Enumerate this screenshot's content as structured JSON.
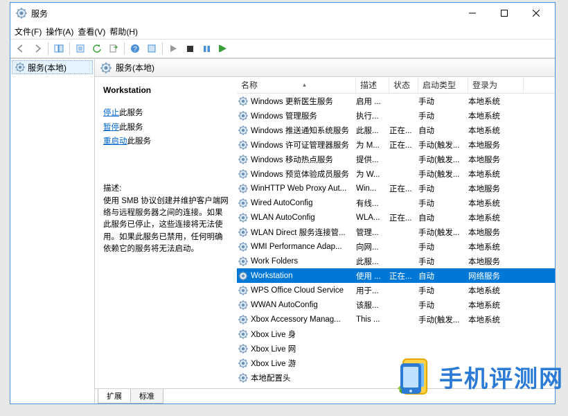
{
  "window": {
    "title": "服务"
  },
  "menu": {
    "file": "文件(F)",
    "action": "操作(A)",
    "view": "查看(V)",
    "help": "帮助(H)"
  },
  "tree": {
    "root": "服务(本地)"
  },
  "header": {
    "label": "服务(本地)"
  },
  "detail": {
    "name": "Workstation",
    "stop_link": "停止",
    "stop_suffix": "此服务",
    "pause_link": "暂停",
    "pause_suffix": "此服务",
    "restart_link": "重启动",
    "restart_suffix": "此服务",
    "desc_label": "描述:",
    "desc": "使用 SMB 协议创建并维护客户端网络与远程服务器之间的连接。如果此服务已停止，这些连接将无法使用。如果此服务已禁用，任何明确依赖它的服务将无法启动。"
  },
  "columns": {
    "name": "名称",
    "desc": "描述",
    "status": "状态",
    "start": "启动类型",
    "logon": "登录为"
  },
  "rows": [
    {
      "name": "Windows 更新医生服务",
      "desc": "启用 ...",
      "status": "",
      "start": "手动",
      "logon": "本地系统"
    },
    {
      "name": "Windows 管理服务",
      "desc": "执行...",
      "status": "",
      "start": "手动",
      "logon": "本地系统"
    },
    {
      "name": "Windows 推送通知系统服务",
      "desc": "此服...",
      "status": "正在...",
      "start": "自动",
      "logon": "本地系统"
    },
    {
      "name": "Windows 许可证管理器服务",
      "desc": "为 M...",
      "status": "正在...",
      "start": "手动(触发...",
      "logon": "本地服务"
    },
    {
      "name": "Windows 移动热点服务",
      "desc": "提供...",
      "status": "",
      "start": "手动(触发...",
      "logon": "本地服务"
    },
    {
      "name": "Windows 预览体验成员服务",
      "desc": "为 W...",
      "status": "",
      "start": "手动(触发...",
      "logon": "本地系统"
    },
    {
      "name": "WinHTTP Web Proxy Aut...",
      "desc": "Win...",
      "status": "正在...",
      "start": "手动",
      "logon": "本地服务"
    },
    {
      "name": "Wired AutoConfig",
      "desc": "有线...",
      "status": "",
      "start": "手动",
      "logon": "本地系统"
    },
    {
      "name": "WLAN AutoConfig",
      "desc": "WLA...",
      "status": "正在...",
      "start": "自动",
      "logon": "本地系统"
    },
    {
      "name": "WLAN Direct 服务连接管...",
      "desc": "管理...",
      "status": "",
      "start": "手动(触发...",
      "logon": "本地服务"
    },
    {
      "name": "WMI Performance Adap...",
      "desc": "向网...",
      "status": "",
      "start": "手动",
      "logon": "本地系统"
    },
    {
      "name": "Work Folders",
      "desc": "此服...",
      "status": "",
      "start": "手动",
      "logon": "本地服务"
    },
    {
      "name": "Workstation",
      "desc": "使用 ...",
      "status": "正在...",
      "start": "自动",
      "logon": "网络服务",
      "selected": true
    },
    {
      "name": "WPS Office Cloud Service",
      "desc": "用于...",
      "status": "",
      "start": "手动",
      "logon": "本地系统"
    },
    {
      "name": "WWAN AutoConfig",
      "desc": "该服...",
      "status": "",
      "start": "手动",
      "logon": "本地系统"
    },
    {
      "name": "Xbox Accessory Manag...",
      "desc": "This ...",
      "status": "",
      "start": "手动(触发...",
      "logon": "本地系统"
    },
    {
      "name": "Xbox Live 身",
      "desc": "",
      "status": "",
      "start": "",
      "logon": ""
    },
    {
      "name": "Xbox Live 网",
      "desc": "",
      "status": "",
      "start": "",
      "logon": ""
    },
    {
      "name": "Xbox Live 游",
      "desc": "",
      "status": "",
      "start": "",
      "logon": ""
    },
    {
      "name": "本地配置头",
      "desc": "",
      "status": "",
      "start": "",
      "logon": ""
    }
  ],
  "tabs": {
    "extended": "扩展",
    "standard": "标准"
  },
  "watermark": "手机评测网"
}
